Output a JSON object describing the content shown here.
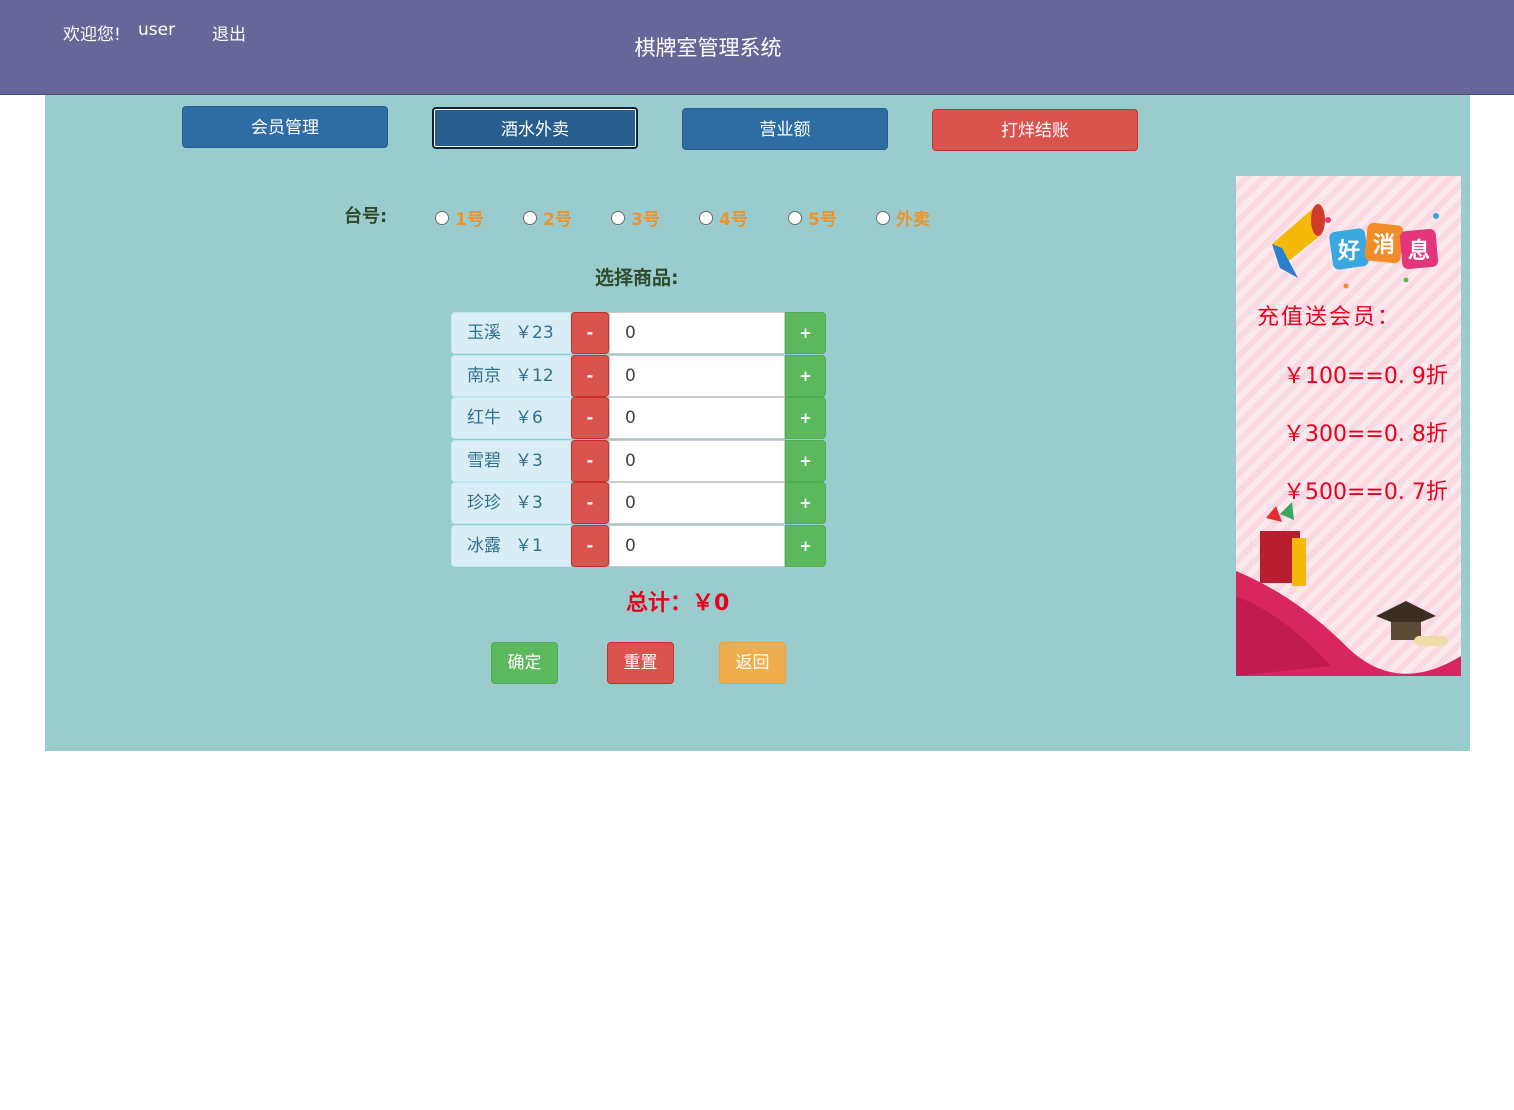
{
  "header": {
    "welcome": "欢迎您!",
    "user": "user",
    "logout": "退出",
    "system_title": "棋牌室管理系统"
  },
  "nav": {
    "member": "会员管理",
    "drinks": "酒水外卖",
    "revenue": "营业额",
    "close": "打烊结账"
  },
  "order": {
    "table_label": "台号:",
    "tables": [
      "1号",
      "2号",
      "3号",
      "4号",
      "5号",
      "外卖"
    ],
    "select_label": "选择商品:",
    "items": [
      {
        "name": "玉溪",
        "price": "￥23",
        "qty": "0"
      },
      {
        "name": "南京",
        "price": "￥12",
        "qty": "0"
      },
      {
        "name": "红牛",
        "price": "￥6",
        "qty": "0"
      },
      {
        "name": "雪碧",
        "price": "￥3",
        "qty": "0"
      },
      {
        "name": "珍珍",
        "price": "￥3",
        "qty": "0"
      },
      {
        "name": "冰露",
        "price": "￥1",
        "qty": "0"
      }
    ],
    "minus": "-",
    "plus": "+",
    "total": "总计：￥0",
    "confirm": "确定",
    "reset": "重置",
    "back": "返回"
  },
  "promo": {
    "headline": "好消息",
    "title": "充值送会员：",
    "rates": [
      "￥100==0. 9折",
      "￥300==0. 8折",
      "￥500==0. 7折"
    ]
  },
  "colors": {
    "header_bg": "#676699",
    "main_bg": "#9acccd",
    "nav_blue": "#2e6da4",
    "danger": "#d9534f",
    "success": "#5cb85c",
    "warning": "#f0ad4e",
    "accent_orange": "#f0932b",
    "total_red": "#e8001c"
  }
}
